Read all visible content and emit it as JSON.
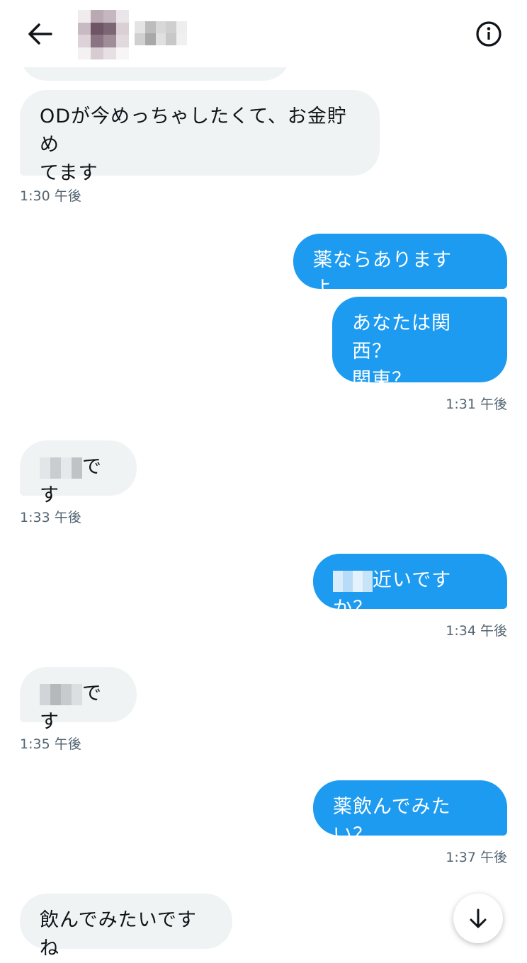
{
  "header": {
    "back_icon": "arrow-left-icon",
    "info_icon": "info-circle-icon"
  },
  "messages": [
    {
      "side": "in",
      "text": "ODが今めっちゃしたくて、お金貯めてます",
      "line1": "ODが今めっちゃしたくて、お金貯め",
      "line2": "てます",
      "time": "1:30 午後"
    },
    {
      "side": "out",
      "text": "薬ならありますよ。"
    },
    {
      "side": "out",
      "text": "あなたは関西？関東？",
      "line1": "あなたは関西？",
      "line2": "関東？",
      "time": "1:31 午後"
    },
    {
      "side": "in",
      "text": "です",
      "time": "1:33 午後"
    },
    {
      "side": "out",
      "text": "近いですか？",
      "time": "1:34 午後"
    },
    {
      "side": "in",
      "text": "です",
      "time": "1:35 午後"
    },
    {
      "side": "out",
      "text": "薬飲んでみたい？",
      "time": "1:37 午後"
    },
    {
      "side": "in",
      "text": "飲んでみたいですね"
    }
  ],
  "scroll_button_icon": "arrow-down-icon",
  "colors": {
    "outgoing_bubble": "#1d9bf0",
    "incoming_bubble": "#eff3f4",
    "timestamp": "#536471"
  }
}
